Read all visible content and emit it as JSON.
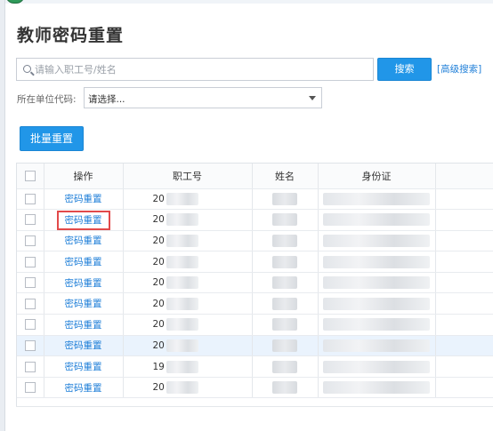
{
  "colors": {
    "accent": "#2196e8",
    "link": "#1f7fd8",
    "highlight": "#e24a4a"
  },
  "page": {
    "title": "教师密码重置"
  },
  "search": {
    "placeholder": "请输入职工号/姓名",
    "button_label": "搜索",
    "advanced_label": "[高级搜索]"
  },
  "filter": {
    "unit_label": "所在单位代码:",
    "unit_value": "请选择..."
  },
  "batch_button_label": "批量重置",
  "table": {
    "headers": [
      "",
      "操作",
      "职工号",
      "姓名",
      "身份证",
      ""
    ],
    "rows": [
      {
        "action": "密码重置",
        "id_prefix": "20"
      },
      {
        "action": "密码重置",
        "id_prefix": "20"
      },
      {
        "action": "密码重置",
        "id_prefix": "20"
      },
      {
        "action": "密码重置",
        "id_prefix": "20"
      },
      {
        "action": "密码重置",
        "id_prefix": "20"
      },
      {
        "action": "密码重置",
        "id_prefix": "20"
      },
      {
        "action": "密码重置",
        "id_prefix": "20"
      },
      {
        "action": "密码重置",
        "id_prefix": "20"
      },
      {
        "action": "密码重置",
        "id_prefix": "19"
      },
      {
        "action": "密码重置",
        "id_prefix": "20"
      }
    ]
  }
}
